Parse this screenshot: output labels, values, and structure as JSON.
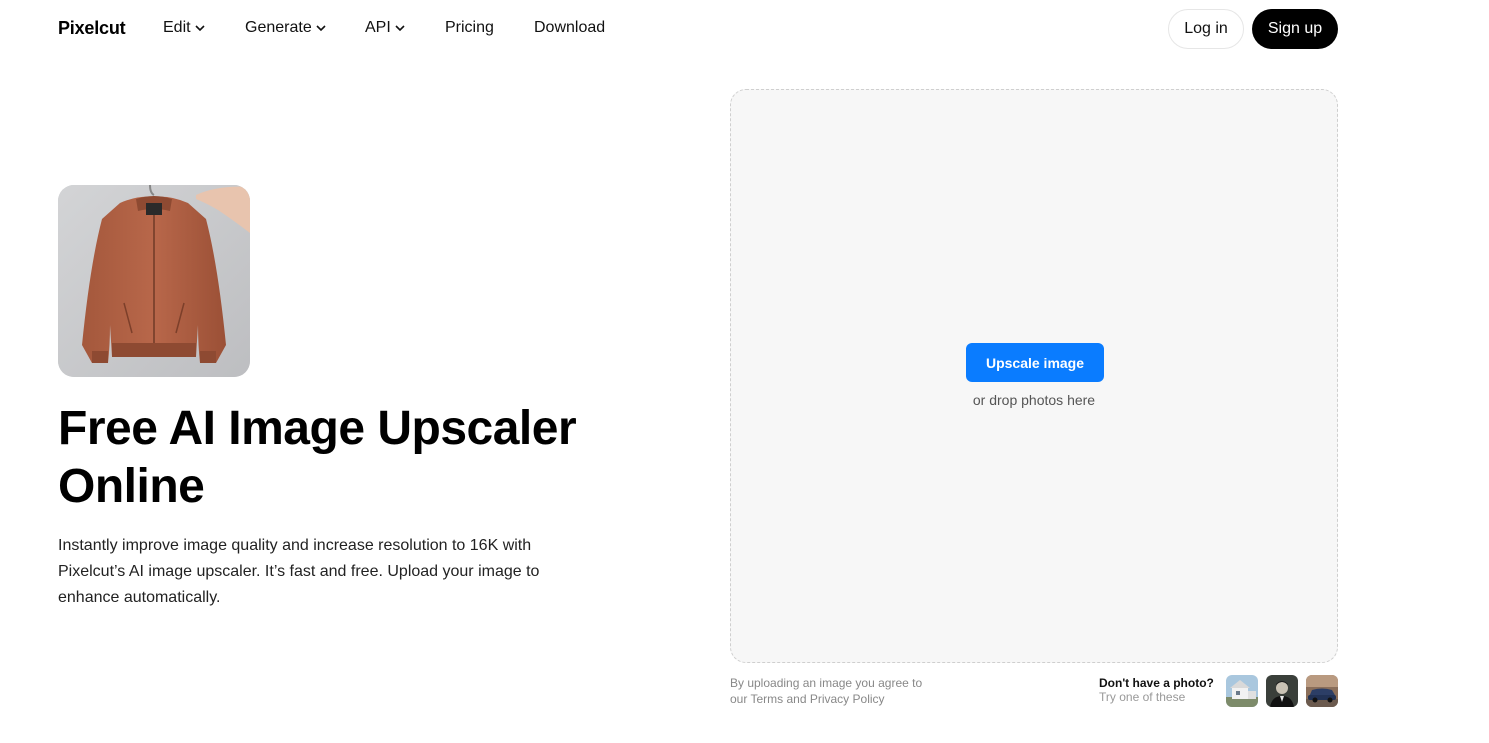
{
  "nav": {
    "logo": "Pixelcut",
    "items": [
      {
        "label": "Edit",
        "has_dropdown": true
      },
      {
        "label": "Generate",
        "has_dropdown": true
      },
      {
        "label": "API",
        "has_dropdown": true
      },
      {
        "label": "Pricing",
        "has_dropdown": false
      },
      {
        "label": "Download",
        "has_dropdown": false
      }
    ],
    "login_label": "Log in",
    "signup_label": "Sign up"
  },
  "hero": {
    "title": "Free AI Image Upscaler Online",
    "description": "Instantly improve image quality and increase resolution to 16K with Pixelcut’s AI image upscaler. It’s fast and free. Upload your image to enhance automatically.",
    "thumbnail_icon": "jacket-photo"
  },
  "upload": {
    "button_label": "Upscale image",
    "drop_hint": "or drop photos here",
    "legal_prefix": "By uploading an image you agree to our ",
    "terms_label": "Terms",
    "legal_and": " and ",
    "privacy_label": "Privacy Policy",
    "samples_title": "Don't have a photo?",
    "samples_subtitle": "Try one of these",
    "samples": [
      "house-photo",
      "portrait-photo",
      "car-photo"
    ]
  },
  "colors": {
    "primary": "#0a7cff",
    "signup_bg": "#000000",
    "dropzone_bg": "#f7f7f7"
  }
}
